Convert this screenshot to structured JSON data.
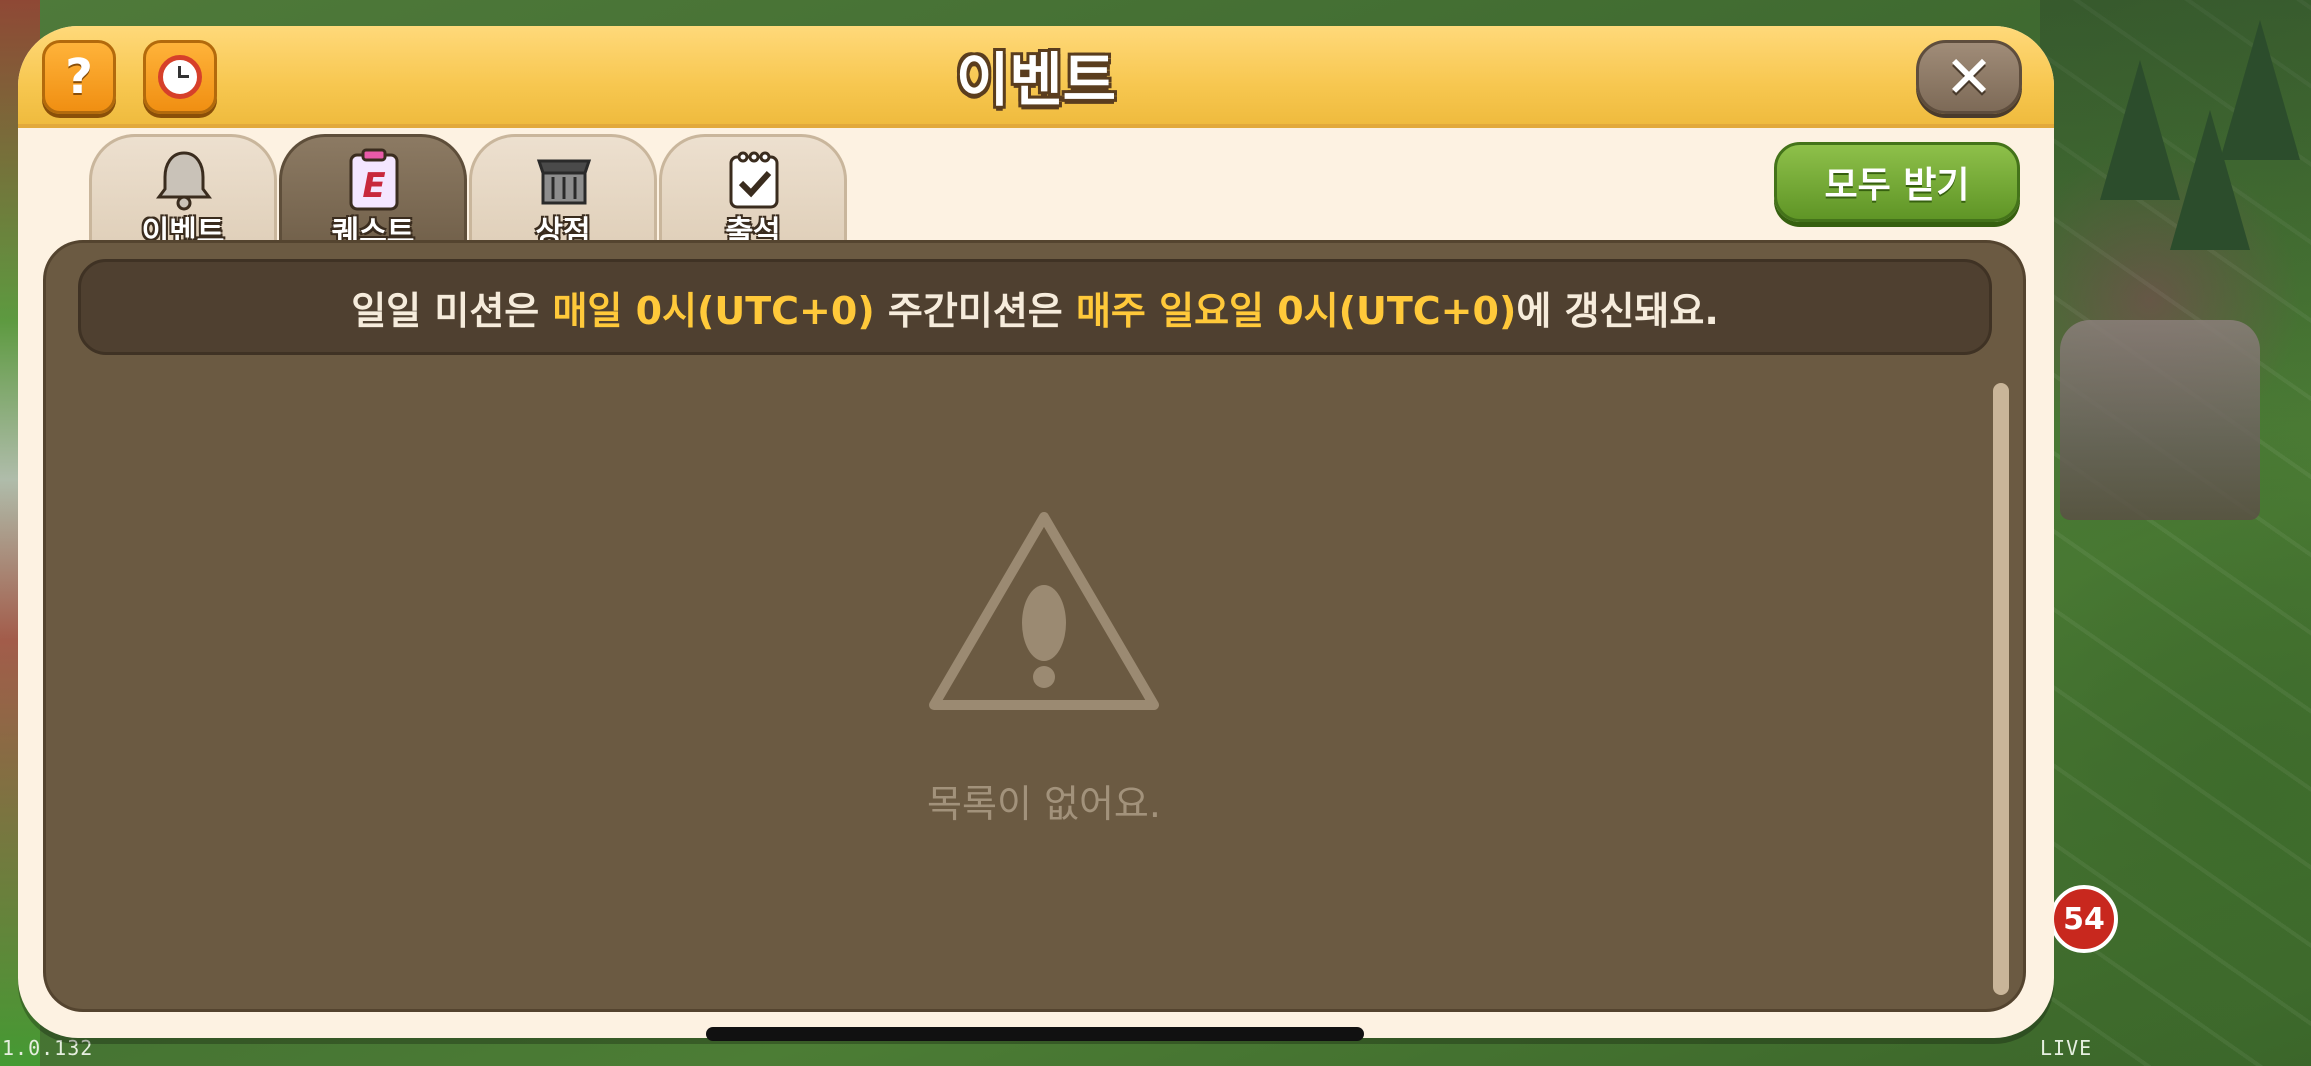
{
  "header": {
    "title": "이벤트",
    "help_label": "?",
    "close_label": "✕",
    "help_icon": "question-icon",
    "alarm_icon": "alarm-clock-icon",
    "close_icon": "close-icon"
  },
  "tabs": [
    {
      "label": "이벤트",
      "icon": "bell-icon",
      "active": false
    },
    {
      "label": "퀘스트",
      "icon": "quest-clipboard-icon",
      "icon_text": "E",
      "active": true
    },
    {
      "label": "상점",
      "icon": "shop-basket-icon",
      "active": false
    },
    {
      "label": "출석",
      "icon": "calendar-check-icon",
      "active": false
    }
  ],
  "claim_all_label": "모두 받기",
  "notice": {
    "part1": "일일 미션은 ",
    "hl1": "매일 0시(UTC+0)",
    "part2": " 주간미션은 ",
    "hl2": "매주 일요일 0시(UTC+0)",
    "part3": "에 갱신돼요."
  },
  "empty": {
    "icon": "warning-icon",
    "message": "목록이 없어요."
  },
  "background": {
    "version": "1.0.132",
    "live_label": "LIVE",
    "badge_count": "54"
  },
  "colors": {
    "header_yellow": "#f7c750",
    "panel_brown": "#6b5a42",
    "highlight": "#ffc93a",
    "claim_green": "#5f9526"
  }
}
